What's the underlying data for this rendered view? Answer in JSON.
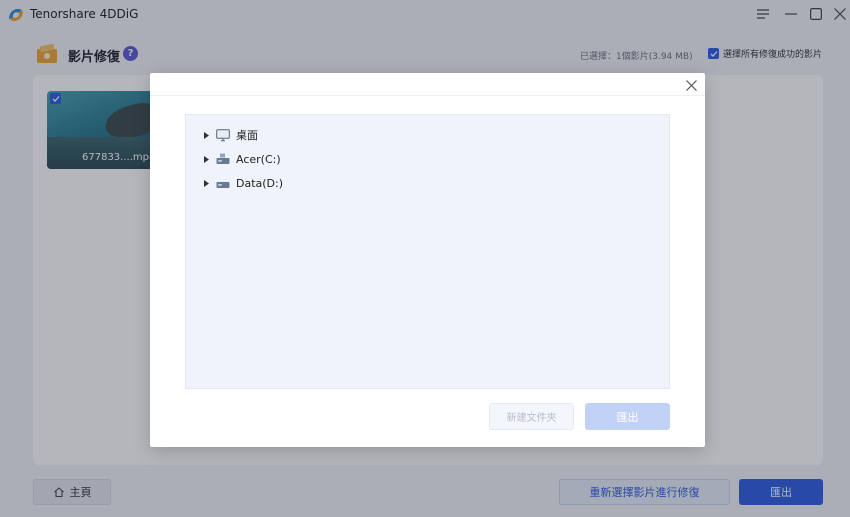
{
  "app": {
    "title": "Tenorshare 4DDiG"
  },
  "window_controls": [
    "menu-icon",
    "minimize-icon",
    "maximize-icon",
    "close-icon"
  ],
  "header": {
    "title": "影片修復",
    "help_symbol": "?",
    "selected_info": "已選擇：1個影片(3.94 MB)",
    "select_all_label": "選擇所有修復成功的影片",
    "select_all_checked": true
  },
  "videos": [
    {
      "name": "677833....mp4",
      "checked": true
    }
  ],
  "footer": {
    "home_label": "主頁",
    "reselect_label": "重新選擇影片進行修復",
    "export_label": "匯出"
  },
  "dialog": {
    "tree": [
      {
        "label": "桌面",
        "icon": "desktop-icon"
      },
      {
        "label": "Acer(C:)",
        "icon": "drive-icon"
      },
      {
        "label": "Data(D:)",
        "icon": "drive-icon"
      }
    ],
    "new_folder_label": "新建文件夾",
    "export_label": "匯出"
  },
  "colors": {
    "accent": "#2f5de0",
    "accent_disabled": "#c2d1f6",
    "help_badge": "#5b5bd6",
    "overlay": "rgba(26,32,48,0.33)"
  }
}
